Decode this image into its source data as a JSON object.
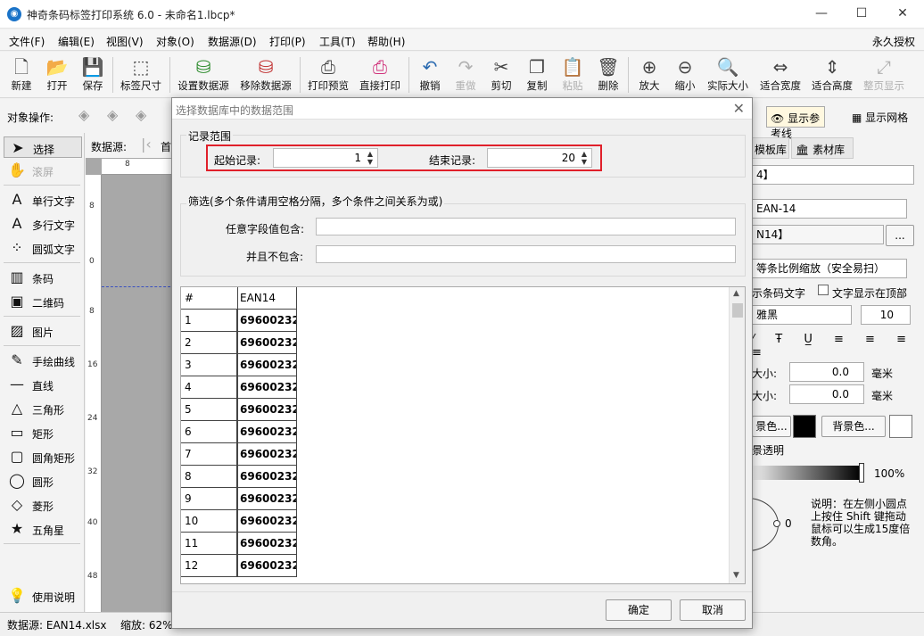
{
  "window": {
    "title": "神奇条码标签打印系统 6.0 - 未命名1.lbcp*",
    "app_icon": "app-logo-icon",
    "minimize": "—",
    "maximize": "☐",
    "close": "✕"
  },
  "menu": {
    "items": [
      "文件(F)",
      "编辑(E)",
      "视图(V)",
      "对象(O)",
      "数据源(D)",
      "打印(P)",
      "工具(T)",
      "帮助(H)"
    ],
    "auth": "永久授权"
  },
  "toolbar": {
    "items": [
      {
        "label": "新建",
        "icon": "new-file-icon",
        "glyph": "🗋",
        "disabled": false
      },
      {
        "label": "打开",
        "icon": "open-icon",
        "glyph": "📂",
        "disabled": false
      },
      {
        "label": "保存",
        "icon": "save-icon",
        "glyph": "💾",
        "disabled": false
      },
      {
        "label": "标签尺寸",
        "icon": "label-size-icon",
        "glyph": "⬚",
        "disabled": false
      },
      {
        "label": "设置数据源",
        "icon": "database-settings-icon",
        "glyph": "⛁",
        "disabled": false
      },
      {
        "label": "移除数据源",
        "icon": "database-remove-icon",
        "glyph": "⛁",
        "disabled": false
      },
      {
        "label": "打印预览",
        "icon": "print-preview-icon",
        "glyph": "⎙",
        "disabled": false
      },
      {
        "label": "直接打印",
        "icon": "print-icon",
        "glyph": "⎙",
        "disabled": false
      },
      {
        "label": "撤销",
        "icon": "undo-icon",
        "glyph": "↶",
        "disabled": false
      },
      {
        "label": "重做",
        "icon": "redo-icon",
        "glyph": "↷",
        "disabled": true
      },
      {
        "label": "剪切",
        "icon": "cut-icon",
        "glyph": "✂",
        "disabled": false
      },
      {
        "label": "复制",
        "icon": "copy-icon",
        "glyph": "❐",
        "disabled": false
      },
      {
        "label": "粘贴",
        "icon": "paste-icon",
        "glyph": "📋",
        "disabled": true
      },
      {
        "label": "删除",
        "icon": "delete-icon",
        "glyph": "🗑",
        "disabled": false
      },
      {
        "label": "放大",
        "icon": "zoom-in-icon",
        "glyph": "⊕",
        "disabled": false
      },
      {
        "label": "缩小",
        "icon": "zoom-out-icon",
        "glyph": "⊖",
        "disabled": false
      },
      {
        "label": "实际大小",
        "icon": "actual-size-icon",
        "glyph": "🔍",
        "disabled": false
      },
      {
        "label": "适合宽度",
        "icon": "fit-width-icon",
        "glyph": "⇔",
        "disabled": false
      },
      {
        "label": "适合高度",
        "icon": "fit-height-icon",
        "glyph": "⇕",
        "disabled": false
      },
      {
        "label": "整页显示",
        "icon": "full-page-icon",
        "glyph": "⤢",
        "disabled": true
      }
    ]
  },
  "objbar": {
    "label": "对象操作:"
  },
  "tools": [
    {
      "label": "选择",
      "icon": "select-arrow-icon",
      "glyph": "➤",
      "selected": true,
      "disabled": false
    },
    {
      "label": "滚屏",
      "icon": "hand-icon",
      "glyph": "✋",
      "selected": false,
      "disabled": true
    },
    {
      "label": "单行文字",
      "icon": "single-line-text-icon",
      "glyph": "A",
      "selected": false,
      "disabled": false
    },
    {
      "label": "多行文字",
      "icon": "multi-line-text-icon",
      "glyph": "A",
      "selected": false,
      "disabled": false
    },
    {
      "label": "圆弧文字",
      "icon": "arc-text-icon",
      "glyph": "⁘",
      "selected": false,
      "disabled": false
    },
    {
      "label": "条码",
      "icon": "barcode-icon",
      "glyph": "▥",
      "selected": false,
      "disabled": false
    },
    {
      "label": "二维码",
      "icon": "qrcode-icon",
      "glyph": "▣",
      "selected": false,
      "disabled": false
    },
    {
      "label": "图片",
      "icon": "image-icon",
      "glyph": "▨",
      "selected": false,
      "disabled": false
    },
    {
      "label": "手绘曲线",
      "icon": "pen-icon",
      "glyph": "✎",
      "selected": false,
      "disabled": false
    },
    {
      "label": "直线",
      "icon": "line-icon",
      "glyph": "—",
      "selected": false,
      "disabled": false
    },
    {
      "label": "三角形",
      "icon": "triangle-icon",
      "glyph": "△",
      "selected": false,
      "disabled": false
    },
    {
      "label": "矩形",
      "icon": "rectangle-icon",
      "glyph": "▭",
      "selected": false,
      "disabled": false
    },
    {
      "label": "圆角矩形",
      "icon": "rounded-rect-icon",
      "glyph": "▢",
      "selected": false,
      "disabled": false
    },
    {
      "label": "圆形",
      "icon": "circle-icon",
      "glyph": "◯",
      "selected": false,
      "disabled": false
    },
    {
      "label": "菱形",
      "icon": "diamond-icon",
      "glyph": "◇",
      "selected": false,
      "disabled": false
    },
    {
      "label": "五角星",
      "icon": "star-icon",
      "glyph": "★",
      "selected": false,
      "disabled": false
    },
    {
      "label": "使用说明",
      "icon": "lightbulb-icon",
      "glyph": "💡",
      "selected": false,
      "disabled": false
    }
  ],
  "canvas": {
    "datasource_label": "数据源:",
    "first_label": "首",
    "ruler_top": [
      "8"
    ],
    "ruler_left": [
      "8",
      "0",
      "8",
      "16",
      "24",
      "32",
      "40",
      "48"
    ]
  },
  "right": {
    "ref_line": "显示参考线",
    "grid": "显示网格",
    "tab_templates": "模板库",
    "tab_assets": "素材库",
    "field1": "4】",
    "field2": "EAN-14",
    "field3": "N14】",
    "ellipsis": "...",
    "scale": "等条比例缩放（安全易扫）",
    "show_text": "示条码文字",
    "text_top": "文字显示在顶部",
    "font": "雅黑",
    "font_size": "10",
    "size1_label": "大小:",
    "size1_val": "0.0",
    "unit1": "毫米",
    "size2_label": "大小:",
    "size2_val": "0.0",
    "unit2": "毫米",
    "fg_btn": "景色...",
    "bg_btn": "背景色...",
    "transparent": "景透明",
    "opacity": "100%",
    "angle": "0",
    "note": "说明：在左侧小圆点上按住 Shift 键拖动鼠标可以生成15度倍数角。"
  },
  "status": {
    "datasource": "数据源: EAN14.xlsx",
    "zoom": "缩放: 62%"
  },
  "dialog": {
    "title": "选择数据库中的数据范围",
    "close": "✕",
    "range_group": "记录范围",
    "start_label": "起始记录:",
    "start_value": "1",
    "end_label": "结束记录:",
    "end_value": "20",
    "filter_group": "筛选(多个条件请用空格分隔，多个条件之间关系为或)",
    "contains_label": "任意字段值包含:",
    "contains_value": "",
    "excludes_label": "并且不包含:",
    "excludes_value": "",
    "grid_headers": [
      "#",
      "EAN14"
    ],
    "rows": [
      [
        "1",
        "69600232"
      ],
      [
        "2",
        "69600232"
      ],
      [
        "3",
        "69600232"
      ],
      [
        "4",
        "69600232"
      ],
      [
        "5",
        "69600232"
      ],
      [
        "6",
        "69600232"
      ],
      [
        "7",
        "69600232"
      ],
      [
        "8",
        "69600232"
      ],
      [
        "9",
        "69600232"
      ],
      [
        "10",
        "69600232"
      ],
      [
        "11",
        "69600232"
      ],
      [
        "12",
        "69600232"
      ]
    ],
    "ok": "确定",
    "cancel": "取消"
  }
}
